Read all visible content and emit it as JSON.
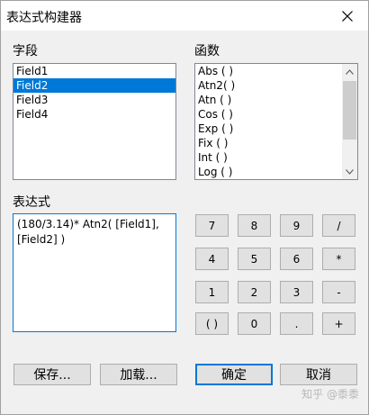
{
  "window": {
    "title": "表达式构建器"
  },
  "fields": {
    "label": "字段",
    "items": [
      "Field1",
      "Field2",
      "Field3",
      "Field4"
    ],
    "selected": "Field2"
  },
  "functions": {
    "label": "函数",
    "items": [
      "Abs ( )",
      "Atn2( )",
      "Atn ( )",
      "Cos ( )",
      "Exp ( )",
      "Fix ( )",
      "Int ( )",
      "Log ( )"
    ]
  },
  "expression": {
    "label": "表达式",
    "value": "(180/3.14)* Atn2( [Field1], [Field2] )"
  },
  "keypad": {
    "k7": "7",
    "k8": "8",
    "k9": "9",
    "kdiv": "/",
    "k4": "4",
    "k5": "5",
    "k6": "6",
    "kmul": "*",
    "k1": "1",
    "k2": "2",
    "k3": "3",
    "ksub": "-",
    "kparen": "( )",
    "k0": "0",
    "kdot": ".",
    "kadd": "+"
  },
  "buttons": {
    "save": "保存...",
    "load": "加载...",
    "ok": "确定",
    "cancel": "取消"
  },
  "watermark": "知乎 @黍黍",
  "colors": {
    "selection": "#0078d7",
    "focus_border": "#0078d7"
  }
}
